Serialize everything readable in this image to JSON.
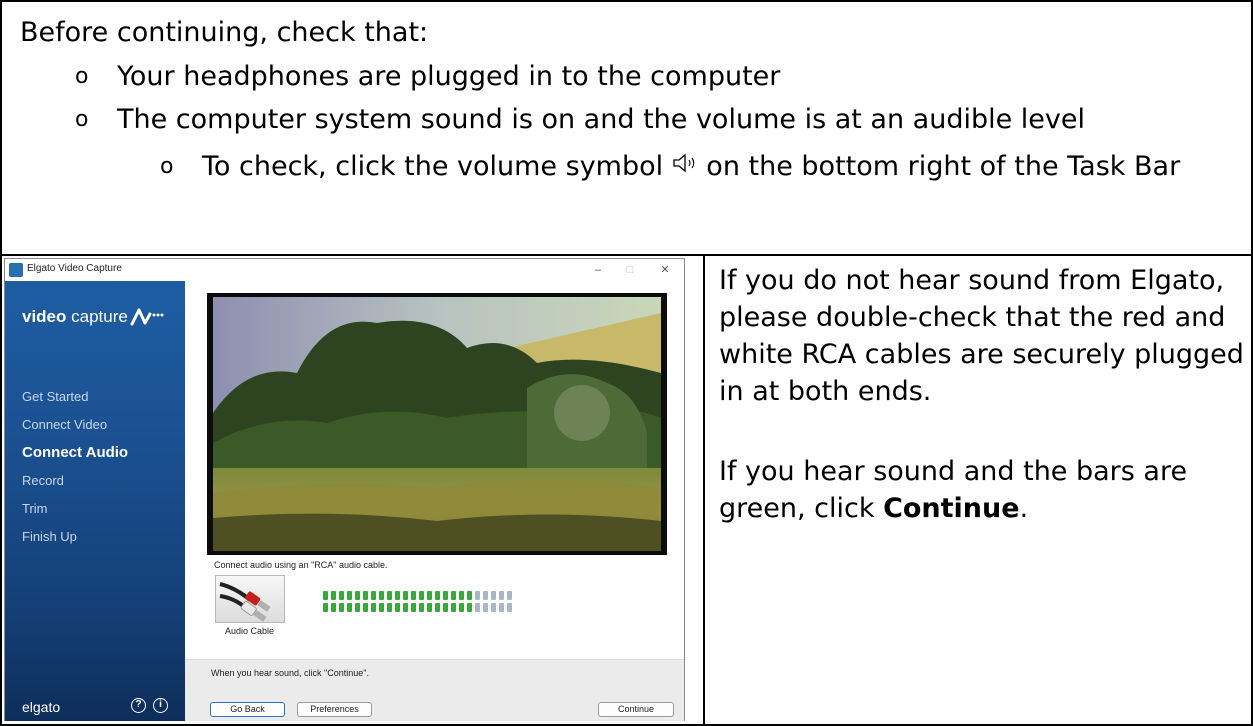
{
  "intro": "Before continuing, check that:",
  "bullets": {
    "marker": "o",
    "b1": "Your headphones are plugged in to the computer",
    "b2": "The computer system sound is on and the volume is at an audible level",
    "b3_before": "To check, click the volume symbol ",
    "b3_after": " on the bottom right of the Task Bar"
  },
  "right": {
    "p1": "If you do not hear sound from Elgato, please double-check that the red and white RCA cables are securely plugged in at both ends.",
    "p2_before": "If you hear sound and the bars are green, click ",
    "p2_bold": "Continue",
    "p2_after": "."
  },
  "app": {
    "title": "Elgato Video Capture",
    "window_buttons": {
      "minimize": "–",
      "maximize": "□",
      "close": "✕"
    },
    "logo_bold": "video",
    "logo_rest": " capture",
    "nav": [
      "Get Started",
      "Connect Video",
      "Connect Audio",
      "Record",
      "Trim",
      "Finish Up"
    ],
    "active_nav": "Connect Audio",
    "brand": "elgato",
    "help_glyph": "?",
    "info_glyph": "i",
    "instruction": "Connect audio using an \"RCA\" audio cable.",
    "cable_label": "Audio Cable",
    "meter": {
      "segments": 24,
      "active_row1": 19,
      "active_row2": 19
    },
    "footer_msg": "When you hear sound, click \"Continue\".",
    "buttons": {
      "back": "Go Back",
      "preferences": "Preferences",
      "continue": "Continue"
    },
    "colors": {
      "sidebar": "#1a4f8f",
      "meter_on": "#39a83a",
      "meter_off": "#a9b6c6"
    },
    "icons": [
      "volume-icon",
      "help-icon",
      "info-icon",
      "rca-cable-icon",
      "elgato-wave-icon"
    ]
  }
}
